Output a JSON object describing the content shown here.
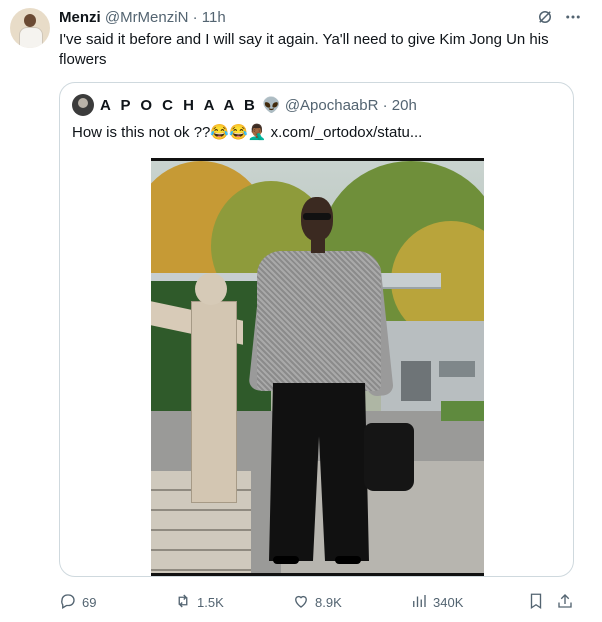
{
  "tweet": {
    "author_name": "Menzi",
    "author_handle": "@MrMenziN",
    "separator": "·",
    "time": "11h",
    "text": "I've said it before and I will say it again. Ya'll need to give Kim Jong Un his flowers",
    "more_icon": "more-horizontal-icon",
    "grok_icon": "grok-icon"
  },
  "quote": {
    "author_name": "A P O C H A A B",
    "emoji": "👽",
    "author_handle": "@ApochaabR",
    "separator": "·",
    "time": "20h",
    "text": "How is this not ok ??😂😂🤦🏾‍♂️ x.com/_ortodox/statu..."
  },
  "actions": {
    "replies": "69",
    "reposts": "1.5K",
    "likes": "8.9K",
    "views": "340K",
    "icons": [
      "reply-icon",
      "repost-icon",
      "like-icon",
      "views-icon",
      "bookmark-icon",
      "share-icon"
    ]
  },
  "colors": {
    "text": "#0f1419",
    "muted": "#536471",
    "border": "#cfd9de"
  }
}
